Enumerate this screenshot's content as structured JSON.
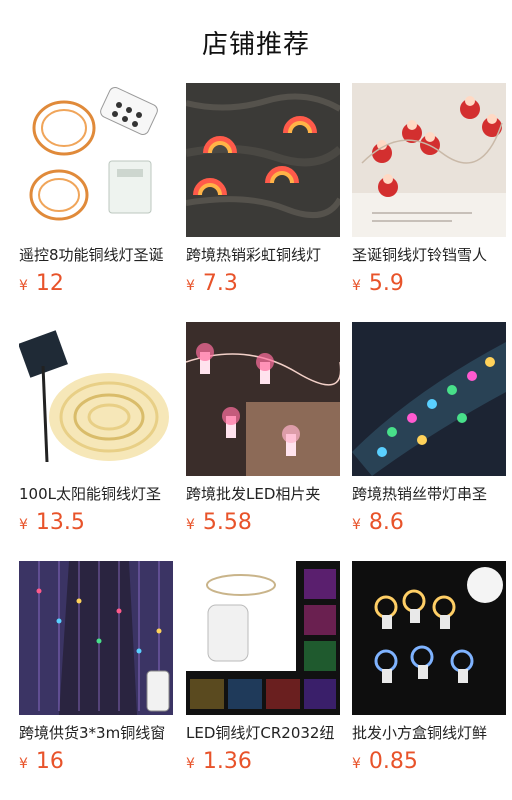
{
  "header": {
    "title": "店铺推荐"
  },
  "products": [
    {
      "name": "遥控8功能铜线灯圣诞",
      "currency": "¥",
      "price": "12",
      "bg": "#ffffff",
      "accent": "#e88a3a"
    },
    {
      "name": "跨境热销彩虹铜线灯",
      "currency": "¥",
      "price": "7.3",
      "bg": "#3b3a37",
      "accent": "#ff9a4a"
    },
    {
      "name": "圣诞铜线灯铃铛雪人",
      "currency": "¥",
      "price": "5.9",
      "bg": "#e9e2da",
      "accent": "#d32f2f"
    },
    {
      "name": "100L太阳能铜线灯圣",
      "currency": "¥",
      "price": "13.5",
      "bg": "#ffffff",
      "accent": "#f3d27a"
    },
    {
      "name": "跨境批发LED相片夹",
      "currency": "¥",
      "price": "5.58",
      "bg": "#3a2d2a",
      "accent": "#ff6fa0"
    },
    {
      "name": "跨境热销丝带灯串圣",
      "currency": "¥",
      "price": "8.6",
      "bg": "#1c2433",
      "accent": "#48e08a"
    },
    {
      "name": "跨境供货3*3m铜线窗",
      "currency": "¥",
      "price": "16",
      "bg": "#2a2440",
      "accent": "#b88cff"
    },
    {
      "name": "LED铜线灯CR2032纽",
      "currency": "¥",
      "price": "1.36",
      "bg": "#111111",
      "accent": "#ffd27a"
    },
    {
      "name": "批发小方盒铜线灯鲜",
      "currency": "¥",
      "price": "0.85",
      "bg": "#0e0e0e",
      "accent": "#ffcf66"
    }
  ]
}
